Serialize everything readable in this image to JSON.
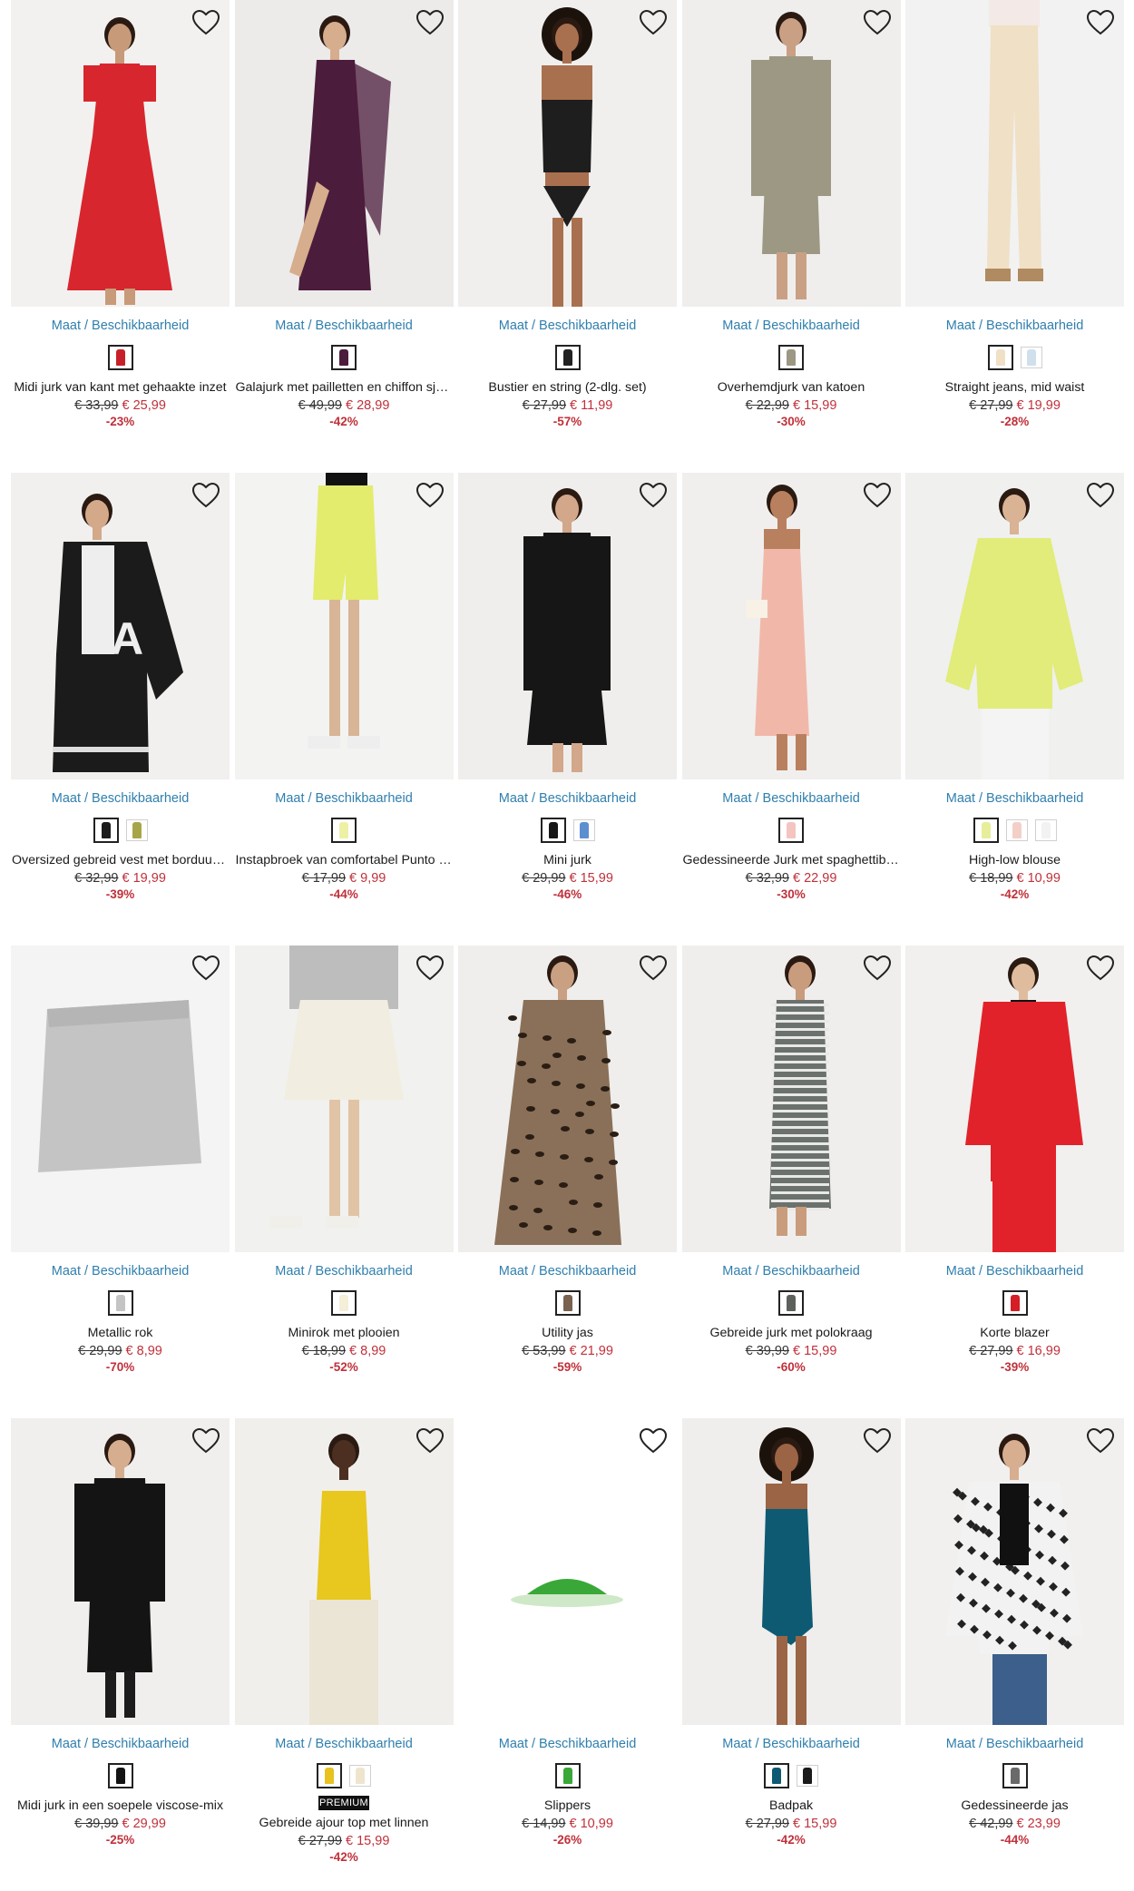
{
  "size_link": "Maat / Beschikbaarheid",
  "premium_badge": "PREMIUM",
  "products": [
    {
      "name": "Midi jurk van kant met gehaakte inzet",
      "old": "€ 33,99",
      "new": "€ 25,99",
      "disc": "-23%",
      "bg": "#f3f1ef",
      "garment": "#d8262e",
      "type": "dress",
      "skin": "#c79a7a",
      "swatches": [
        "#c8202a"
      ]
    },
    {
      "name": "Galajurk met pailletten en chiffon sjaal",
      "old": "€ 49,99",
      "new": "€ 28,99",
      "disc": "-42%",
      "bg": "#ecebe9",
      "garment": "#4c1c3c",
      "type": "gown",
      "skin": "#d6ad8d",
      "swatches": [
        "#4c1c3c"
      ]
    },
    {
      "name": "Bustier en string (2-dlg. set)",
      "old": "€ 27,99",
      "new": "€ 11,99",
      "disc": "-57%",
      "bg": "#f0efed",
      "garment": "#1e1e1e",
      "type": "lingerie",
      "skin": "#a9704f",
      "swatches": [
        "#222222"
      ]
    },
    {
      "name": "Overhemdjurk van katoen",
      "old": "€ 22,99",
      "new": "€ 15,99",
      "disc": "-30%",
      "bg": "#efeeec",
      "garment": "#9c9883",
      "type": "shirtdress",
      "skin": "#c9a084",
      "swatches": [
        "#9c9883"
      ]
    },
    {
      "name": "Straight jeans, mid waist",
      "old": "€ 27,99",
      "new": "€ 19,99",
      "disc": "-28%",
      "bg": "#f2f2f2",
      "garment": "#f0e0c6",
      "type": "pants",
      "skin": "#e0c0a5",
      "swatches": [
        "#f0e0c6",
        "#cfe0ec"
      ]
    },
    {
      "name": "Oversized gebreid vest met borduursel",
      "old": "€ 32,99",
      "new": "€ 19,99",
      "disc": "-39%",
      "bg": "#f1f0ee",
      "garment": "#1b1b1b",
      "type": "cardigan",
      "skin": "#d3a98a",
      "swatches": [
        "#1b1b1b",
        "#a8a548"
      ]
    },
    {
      "name": "Instapbroek van comfortabel Punto di Roma",
      "old": "€ 17,99",
      "new": "€ 9,99",
      "disc": "-44%",
      "bg": "#f3f3f1",
      "garment": "#e3ec6c",
      "type": "shorts",
      "skin": "#d8b596",
      "swatches": [
        "#eef0a6"
      ]
    },
    {
      "name": "Mini jurk",
      "old": "€ 29,99",
      "new": "€ 15,99",
      "disc": "-46%",
      "bg": "#efeeec",
      "garment": "#161616",
      "type": "minidress",
      "skin": "#d2a78a",
      "swatches": [
        "#161616",
        "#5b8fd0"
      ]
    },
    {
      "name": "Gedessineerde Jurk met spaghettibandjes",
      "old": "€ 32,99",
      "new": "€ 22,99",
      "disc": "-30%",
      "bg": "#f0efed",
      "garment": "#f1b8aa",
      "type": "slipdress",
      "skin": "#b9805f",
      "swatches": [
        "#f4c4c0"
      ]
    },
    {
      "name": "High-low blouse",
      "old": "€ 18,99",
      "new": "€ 10,99",
      "disc": "-42%",
      "bg": "#f0f0ef",
      "garment": "#e1ec7a",
      "type": "blouse",
      "skin": "#d9b394",
      "swatches": [
        "#e7ee9a",
        "#f3cfc8",
        "#f2f2f2"
      ]
    },
    {
      "name": "Metallic rok",
      "old": "€ 29,99",
      "new": "€ 8,99",
      "disc": "-70%",
      "bg": "#f4f4f4",
      "garment": "#c4c4c4",
      "type": "skirtflat",
      "skin": "#000000",
      "swatches": [
        "#c4c4c4"
      ]
    },
    {
      "name": "Minirok met plooien",
      "old": "€ 18,99",
      "new": "€ 8,99",
      "disc": "-52%",
      "bg": "#f1f1ef",
      "garment": "#f1ede0",
      "type": "pleatskirt",
      "skin": "#e1c4a6",
      "swatches": [
        "#f3efd9"
      ]
    },
    {
      "name": "Utility jas",
      "old": "€ 53,99",
      "new": "€ 21,99",
      "disc": "-59%",
      "bg": "#efeeec",
      "garment": "#8a7058",
      "type": "leopard",
      "skin": "#c9a082",
      "swatches": [
        "#7a6250"
      ]
    },
    {
      "name": "Gebreide jurk met polokraag",
      "old": "€ 39,99",
      "new": "€ 15,99",
      "disc": "-60%",
      "bg": "#efeeec",
      "garment": "#6b716c",
      "type": "stripedress",
      "skin": "#c99c7d",
      "swatches": [
        "#5d615d"
      ]
    },
    {
      "name": "Korte blazer",
      "old": "€ 27,99",
      "new": "€ 16,99",
      "disc": "-39%",
      "bg": "#f1f0ee",
      "garment": "#e2222a",
      "type": "blazer",
      "skin": "#e0bc9e",
      "swatches": [
        "#d51e26"
      ]
    },
    {
      "name": "Midi jurk in een soepele viscose-mix",
      "old": "€ 39,99",
      "new": "€ 29,99",
      "disc": "-25%",
      "bg": "#f0efed",
      "garment": "#141414",
      "type": "blackmidi",
      "skin": "#d6ad8e",
      "swatches": [
        "#141414"
      ]
    },
    {
      "name": "Gebreide ajour top met linnen",
      "old": "€ 27,99",
      "new": "€ 15,99",
      "disc": "-42%",
      "bg": "#f1efec",
      "garment": "#e8c71e",
      "type": "knittop",
      "skin": "#4d2f22",
      "swatches": [
        "#e8c21e",
        "#efe5cf"
      ],
      "premium": true
    },
    {
      "name": "Slippers",
      "old": "€ 14,99",
      "new": "€ 10,99",
      "disc": "-26%",
      "bg": "#ffffff",
      "garment": "#3aa838",
      "type": "slipper",
      "skin": "#000000",
      "swatches": [
        "#3aa838"
      ]
    },
    {
      "name": "Badpak",
      "old": "€ 27,99",
      "new": "€ 15,99",
      "disc": "-42%",
      "bg": "#efeeec",
      "garment": "#0f5a73",
      "type": "swimsuit",
      "skin": "#9b6444",
      "swatches": [
        "#0f5a73",
        "#1a1a1a"
      ]
    },
    {
      "name": "Gedessineerde jas",
      "old": "€ 42,99",
      "new": "€ 23,99",
      "disc": "-44%",
      "bg": "#f1f0ee",
      "garment": "#222222",
      "type": "houndstooth",
      "skin": "#d7ae90",
      "swatches": [
        "#6a6a6a"
      ]
    }
  ]
}
